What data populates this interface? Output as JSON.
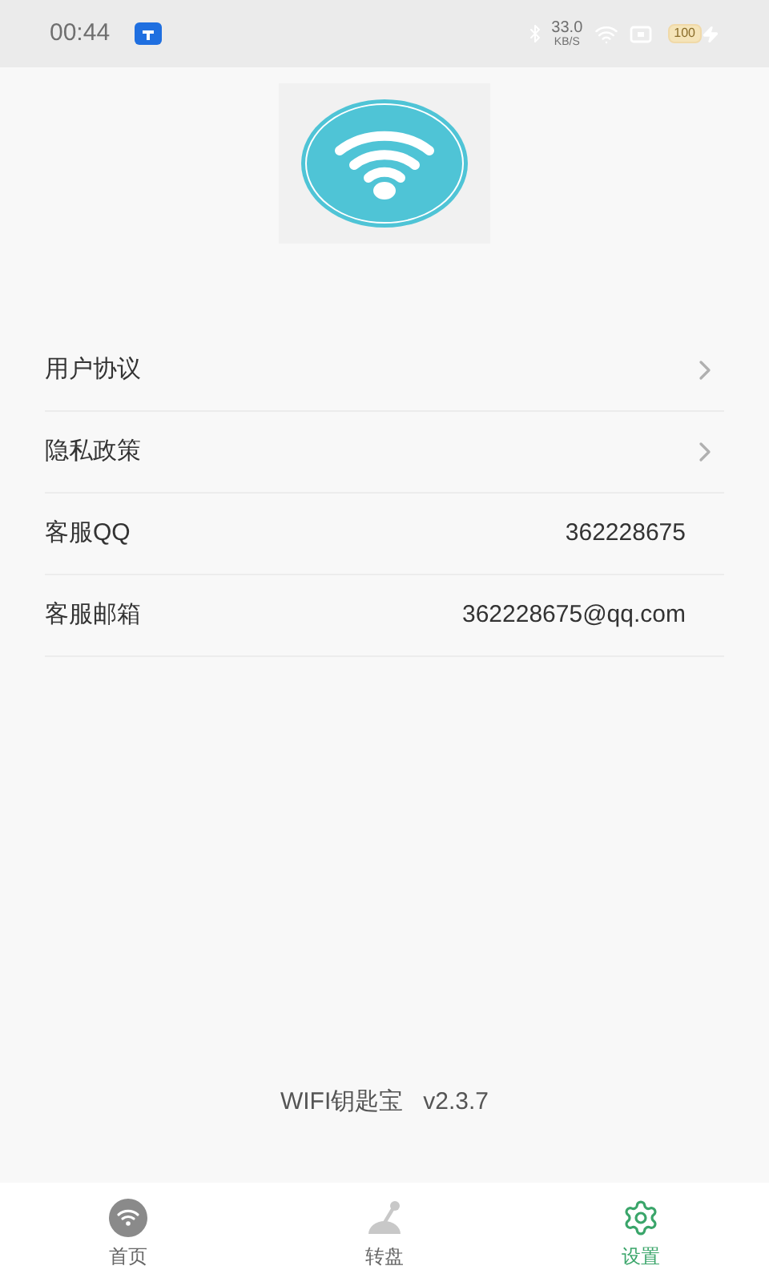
{
  "status_bar": {
    "time": "00:44",
    "speed": "33.0",
    "speed_unit": "KB/S",
    "battery": "100"
  },
  "menu": [
    {
      "label": "用户协议",
      "kind": "link"
    },
    {
      "label": "隐私政策",
      "kind": "link"
    },
    {
      "label": "客服QQ",
      "kind": "info",
      "value": "362228675"
    },
    {
      "label": "客服邮箱",
      "kind": "info",
      "value": "362228675@qq.com"
    }
  ],
  "footer": {
    "app_name": "WIFI钥匙宝",
    "version": "v2.3.7"
  },
  "tabs": [
    {
      "label": "首页",
      "kind": "home",
      "selected": false
    },
    {
      "label": "转盘",
      "kind": "wheel",
      "selected": false
    },
    {
      "label": "设置",
      "kind": "settings",
      "selected": true
    }
  ]
}
